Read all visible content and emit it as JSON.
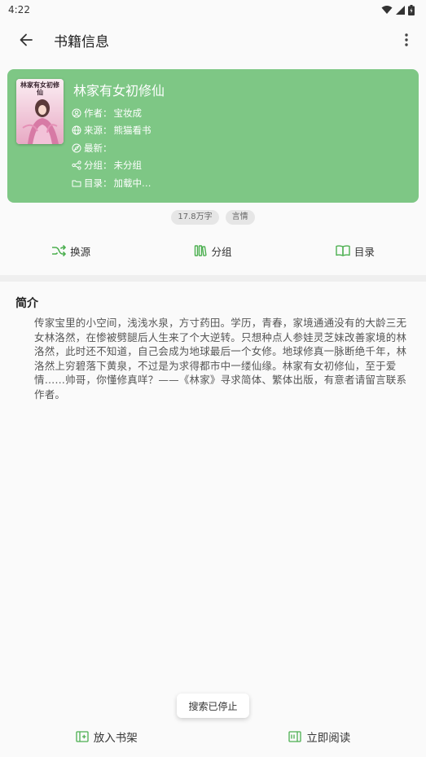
{
  "status_bar": {
    "time": "4:22"
  },
  "app_bar": {
    "title": "书籍信息"
  },
  "book": {
    "title": "林家有女初修仙",
    "cover_text": "林家有女初修仙",
    "meta": [
      {
        "icon": "author-icon",
        "label": "作者：",
        "value": "宝妆成"
      },
      {
        "icon": "globe-icon",
        "label": "来源：",
        "value": "熊猫看书"
      },
      {
        "icon": "compass-icon",
        "label": "最新：",
        "value": ""
      },
      {
        "icon": "share-icon",
        "label": "分组：",
        "value": "未分组"
      },
      {
        "icon": "folder-icon",
        "label": "目录：",
        "value": "加载中…"
      }
    ]
  },
  "tags": [
    "17.8万字",
    "言情"
  ],
  "actions": {
    "change_source": "换源",
    "group": "分组",
    "toc": "目录"
  },
  "intro": {
    "title": "简介",
    "text": "传家宝里的小空间，浅浅水泉，方寸药田。学历，青春，家境通通没有的大龄三无女林洛然，在惨被劈腿后人生来了个大逆转。只想种点人参娃灵芝妹改善家境的林洛然，此时还不知道，自己会成为地球最后一个女修。地球修真一脉断绝千年，林洛然上穷碧落下黄泉，不过是为求得都市中一缕仙缘。林家有女初修仙，至于爱情……帅哥，你懂修真咩？——《林家》寻求简体、繁体出版，有意者请留言联系作者。"
  },
  "toast": "搜索已停止",
  "bottom": {
    "shelf": "放入书架",
    "read": "立即阅读"
  },
  "colors": {
    "card": "#7ec785",
    "accent": "#4caf50"
  }
}
